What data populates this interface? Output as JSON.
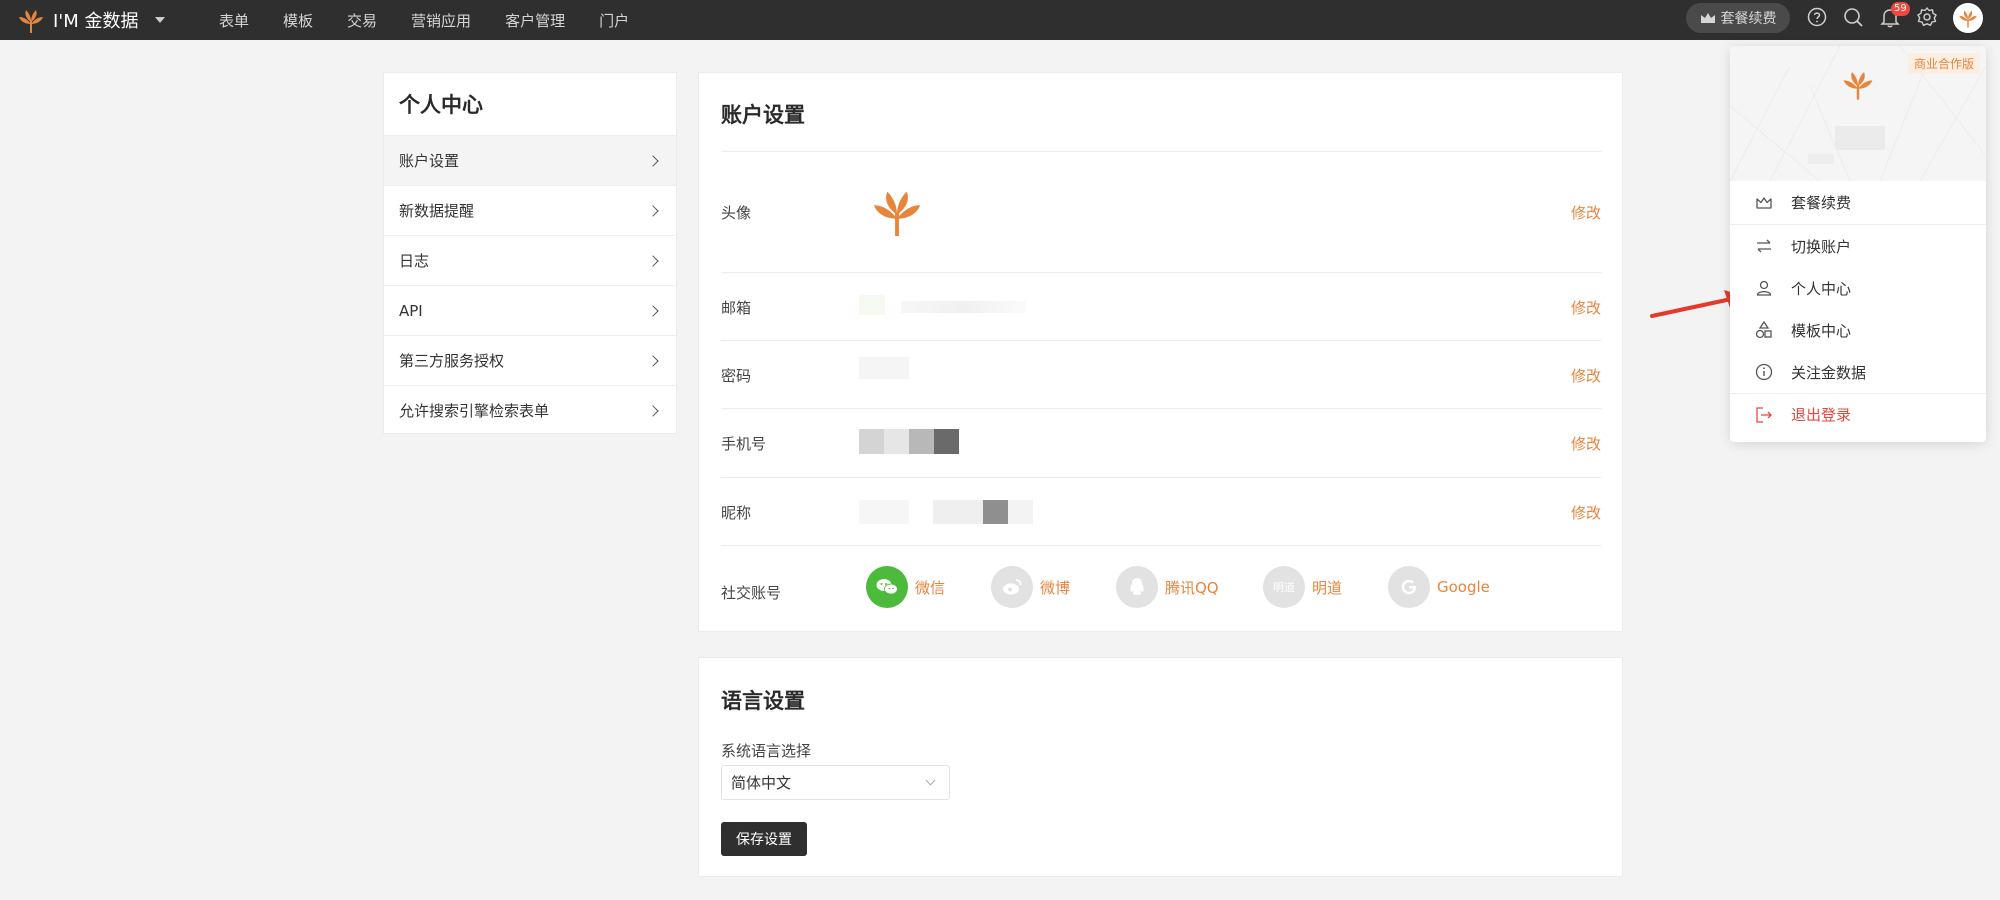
{
  "app": {
    "brand": "I'M 金数据"
  },
  "nav": {
    "items": [
      "表单",
      "模板",
      "交易",
      "营销应用",
      "客户管理",
      "门户"
    ]
  },
  "topbar": {
    "renew_label": "套餐续费",
    "notification_count": "59"
  },
  "sidebar": {
    "title": "个人中心",
    "items": [
      {
        "label": "账户设置"
      },
      {
        "label": "新数据提醒"
      },
      {
        "label": "日志"
      },
      {
        "label": "API"
      },
      {
        "label": "第三方服务授权"
      },
      {
        "label": "允许搜索引擎检索表单"
      }
    ]
  },
  "account": {
    "title": "账户设置",
    "edit_label": "修改",
    "rows": {
      "avatar": "头像",
      "email": "邮箱",
      "password": "密码",
      "phone": "手机号",
      "nickname": "昵称",
      "social": "社交账号"
    },
    "social": [
      {
        "label": "微信",
        "icon": "wechat-icon"
      },
      {
        "label": "微博",
        "icon": "weibo-icon"
      },
      {
        "label": "腾讯QQ",
        "icon": "qq-icon"
      },
      {
        "label": "明道",
        "icon": "mingdao-icon",
        "icon_text": "明道"
      },
      {
        "label": "Google",
        "icon": "google-icon"
      }
    ]
  },
  "language": {
    "title": "语言设置",
    "label": "系统语言选择",
    "selected": "简体中文",
    "save_label": "保存设置"
  },
  "dropdown": {
    "badge": "商业合作版",
    "items": [
      {
        "label": "套餐续费",
        "icon": "crown-icon"
      },
      {
        "label": "切换账户",
        "icon": "switch-icon"
      },
      {
        "label": "个人中心",
        "icon": "user-icon"
      },
      {
        "label": "模板中心",
        "icon": "shapes-icon"
      },
      {
        "label": "关注金数据",
        "icon": "info-icon"
      },
      {
        "label": "退出登录",
        "icon": "logout-icon"
      }
    ]
  },
  "colors": {
    "accent": "#e8853d",
    "topbar": "#2f2f2f",
    "danger": "#e8463d",
    "wechat": "#4cba3b"
  }
}
